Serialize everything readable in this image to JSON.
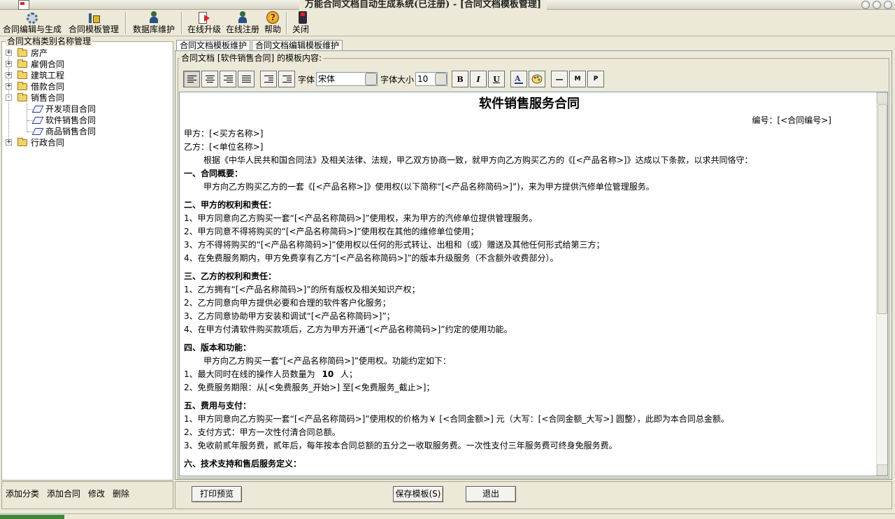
{
  "window": {
    "title": "万能合同文档自动生成系统(已注册) - [合同文档模板管理]"
  },
  "toolbar": {
    "items": [
      {
        "label": "合同编辑与生成",
        "icon": "gear-icon"
      },
      {
        "label": "合同模板管理",
        "icon": "chart-icon"
      },
      {
        "label": "数据库维护",
        "icon": "person-icon"
      },
      {
        "label": "在线升级",
        "icon": "upgrade-icon"
      },
      {
        "label": "在线注册",
        "icon": "person-icon"
      },
      {
        "label": "帮助",
        "icon": "help-icon"
      },
      {
        "label": "关闭",
        "icon": "close-icon"
      }
    ]
  },
  "left": {
    "title": "合同文档类别名称管理",
    "tree": [
      {
        "label": "房产",
        "type": "folder",
        "expander": "+"
      },
      {
        "label": "雇佣合同",
        "type": "folder",
        "expander": "+"
      },
      {
        "label": "建筑工程",
        "type": "folder",
        "expander": "+"
      },
      {
        "label": "借款合同",
        "type": "folder",
        "expander": "+"
      },
      {
        "label": "销售合同",
        "type": "folder",
        "expander": "-"
      },
      {
        "label": "开发项目合同",
        "type": "doc"
      },
      {
        "label": "软件销售合同",
        "type": "doc"
      },
      {
        "label": "商品销售合同",
        "type": "doc"
      },
      {
        "label": "行政合同",
        "type": "folder",
        "expander": "+"
      }
    ],
    "actions": {
      "add_category": "添加分类",
      "add_contract": "添加合同",
      "edit": "修改",
      "delete": "删除"
    }
  },
  "tabs": [
    "合同文档模板维护",
    "合同文档编辑模板维护"
  ],
  "editor_panel": {
    "legend": "合同文档 [软件销售合同] 的模板内容:",
    "font_label": "字体",
    "font_value": "宋体",
    "size_label": "字体大小",
    "size_value": "10",
    "bold": "B",
    "italic": "I",
    "underline": "U",
    "dash": "—",
    "m": "M",
    "p": "P"
  },
  "document": {
    "title": "软件销售服务合同",
    "number": "编号：[<合同编号>]",
    "party_a": "甲方：[<买方名称>]",
    "party_b": "乙方：[<单位名称>]",
    "preamble": "根据《中华人民共和国合同法》及相关法律、法规，甲乙双方协商一致，就甲方向乙方购买乙方的《[<产品名称>]》达成以下条款，以求共同恪守：",
    "s1_title": "一、合同概要：",
    "s1_body": "甲方向乙方购买乙方的一套《[<产品名称>]》使用权(以下简称“[<产品名称简码>]”)，来为甲方提供汽修单位管理服务。",
    "s2_title": "二、甲方的权利和责任：",
    "s2_items": [
      "1、甲方同意向乙方购买一套“[<产品名称简码>]”使用权，来为甲方的汽修单位提供管理服务。",
      "2、甲方同意不得将购买的“[<产品名称简码>]”使用权在其他的维修单位使用；",
      "3、方不得将购买的“[<产品名称简码>]”使用权以任何的形式转让、出租和（或）赠送及其他任何形式给第三方；",
      "4、在免费服务期内，甲方免费享有乙方“[<产品名称简码>]”的版本升级服务（不含额外收费部分）。"
    ],
    "s3_title": "三、乙方的权利和责任：",
    "s3_items": [
      "1、乙方拥有“[<产品名称简码>]”的所有版权及相关知识产权；",
      "2、乙方同意向甲方提供必要和合理的软件客户化服务；",
      "3、乙方同意协助甲方安装和调试“[<产品名称简码>]”；",
      "4、在甲方付清软件购买款项后，乙方为甲方开通“[<产品名称简码>]”约定的使用功能。"
    ],
    "s4_title": "四、版本和功能：",
    "s4_body": "甲方向乙方购买一套“[<产品名称简码>]”使用权。功能约定如下：",
    "s4_item1_prefix": "1、最大同时在线的操作人员数量为",
    "s4_item1_value": "10",
    "s4_item1_suffix": "人；",
    "s4_item2": "2、免费服务期限：从[<免费服务_开始>] 至[<免费服务_截止>]；",
    "s5_title": "五、费用与支付：",
    "s5_items": [
      "1、甲方同意向乙方购买一套“[<产品名称简码>]”使用权的价格为￥ [<合同金额>]  元（大写：[<合同金额_大写>] 圆整），此即为本合同总金额。",
      "2、支付方式：甲方一次性付清合同总额。",
      "3、免收前贰年服务费，贰年后，每年按本合同总额的五分之一收取服务费。一次性支付三年服务费可终身免服务费。"
    ],
    "s6_title": "六、技术支持和售后服务定义："
  },
  "bottom": {
    "print_preview": "打印预览",
    "save_template": "保存模板(S)",
    "exit": "退出"
  }
}
